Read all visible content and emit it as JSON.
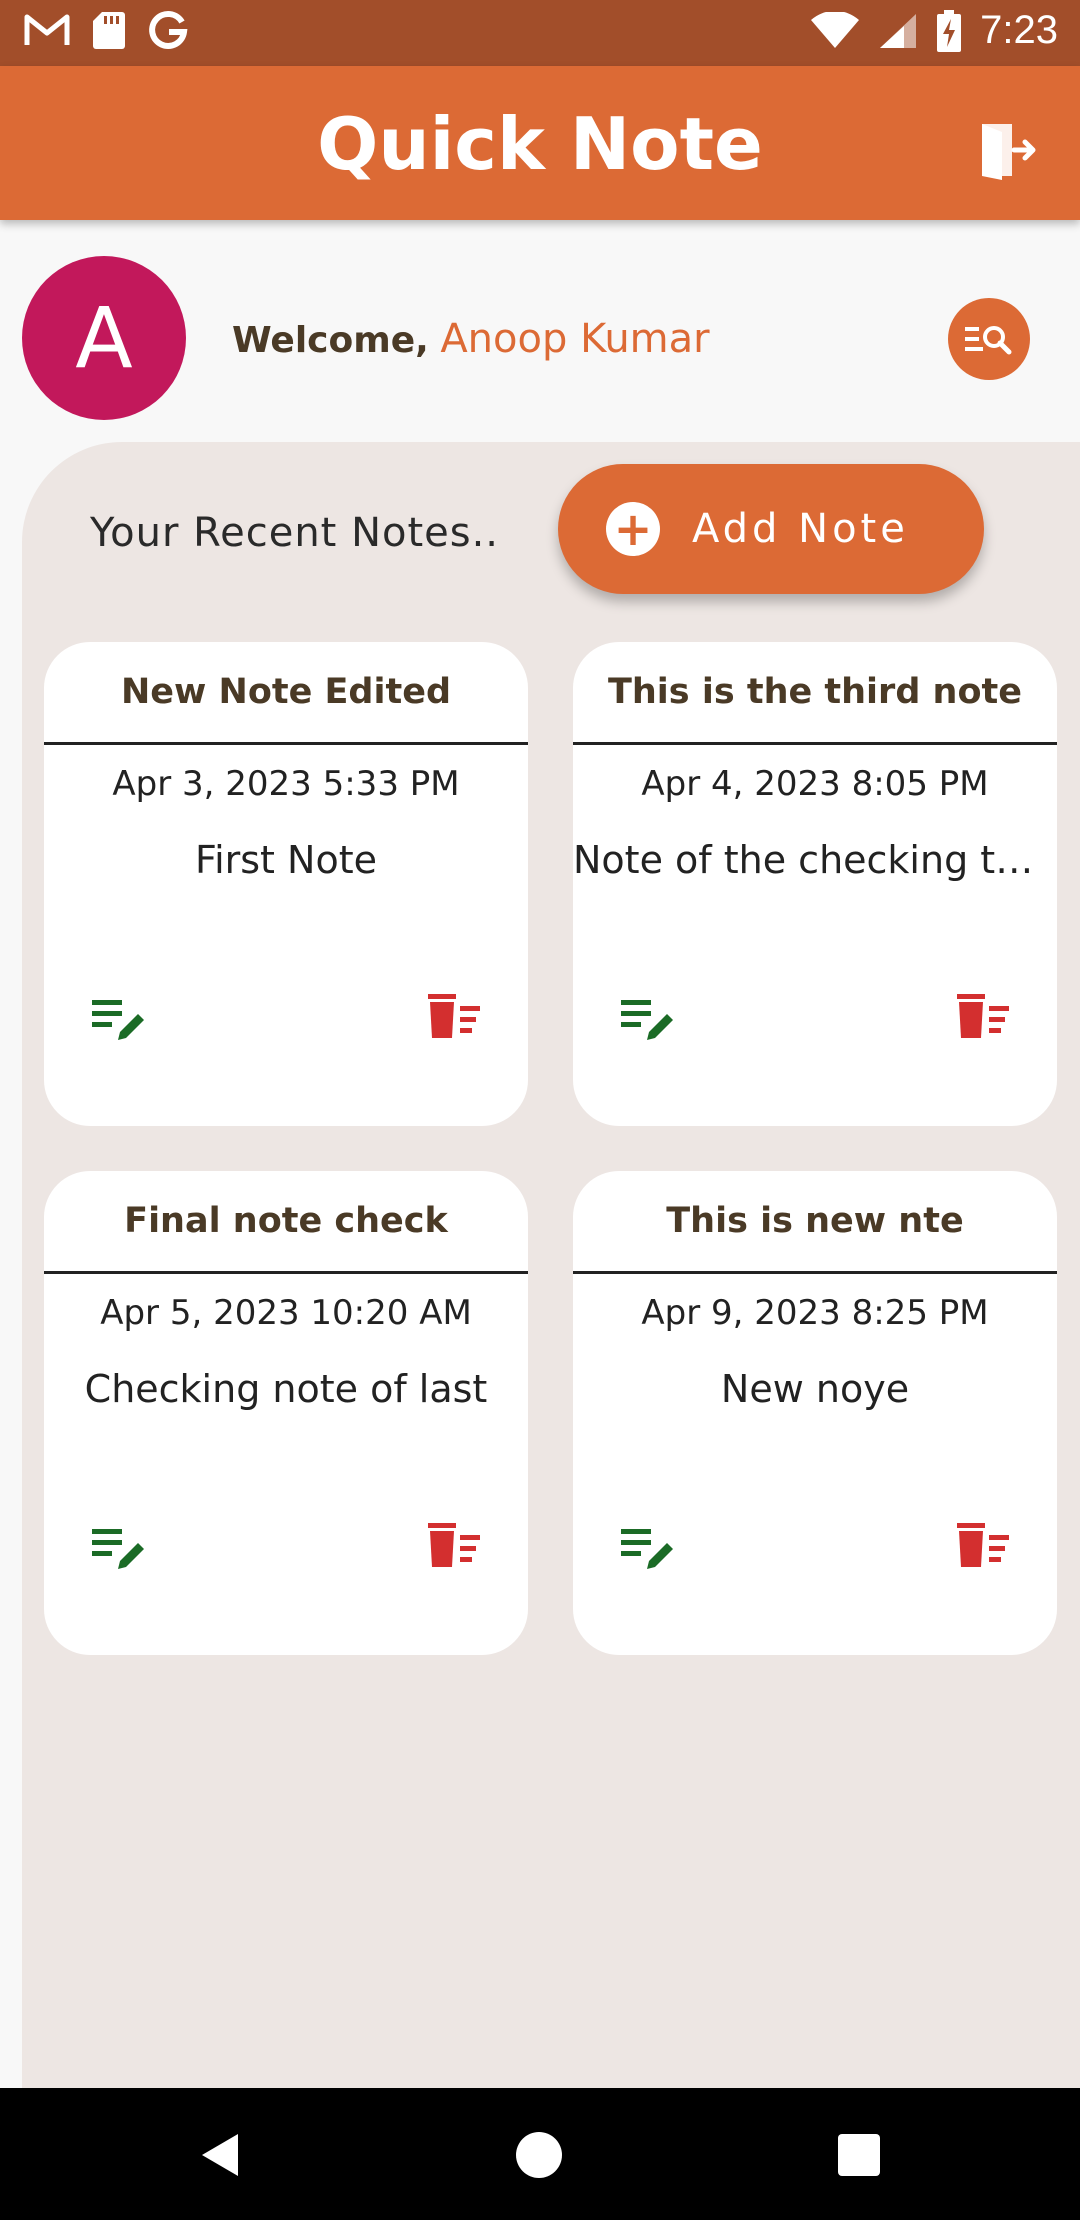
{
  "status": {
    "time": "7:23",
    "left_icons": [
      "gmail-icon",
      "sd-card-icon",
      "google-icon"
    ],
    "right_icons": [
      "wifi-icon",
      "signal-icon",
      "battery-charging-icon"
    ]
  },
  "app_bar": {
    "title": "Quick Note",
    "logout_icon": "logout-icon"
  },
  "user": {
    "avatar_letter": "A",
    "welcome_label": "Welcome,",
    "name": "Anoop Kumar",
    "search_icon": "search-icon"
  },
  "notes_section": {
    "recent_label": "Your Recent Notes..",
    "add_note_label": "Add Note"
  },
  "notes": [
    {
      "title": "New Note Edited",
      "date": "Apr 3, 2023 5:33 PM",
      "body": "First Note"
    },
    {
      "title": "This is the third note",
      "date": "Apr 4, 2023 8:05 PM",
      "body": "Note of the checking thir..."
    },
    {
      "title": "Final note check",
      "date": "Apr 5, 2023 10:20 AM",
      "body": "Checking note of last"
    },
    {
      "title": "This is new nte",
      "date": "Apr 9, 2023 8:25 PM",
      "body": "New noye"
    }
  ],
  "colors": {
    "status_bar": "#a24e2a",
    "app_bar": "#dc6a35",
    "accent": "#dc6a35",
    "avatar": "#c2185b",
    "edit_icon": "#1b6b26",
    "delete_icon": "#d32f2f",
    "panel": "#ede6e3"
  }
}
